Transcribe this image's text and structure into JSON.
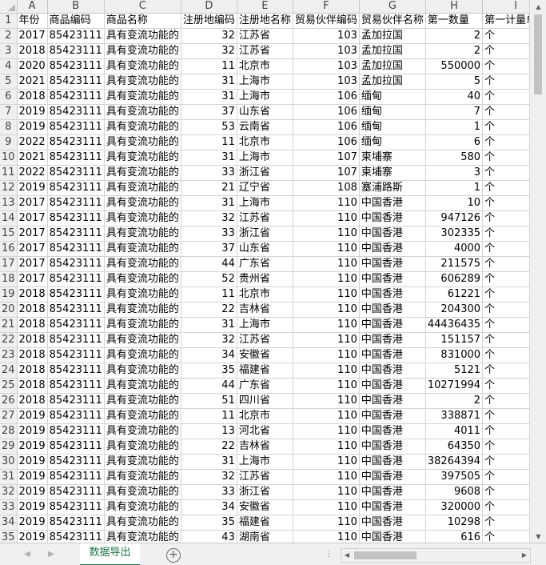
{
  "columns": [
    "A",
    "B",
    "C",
    "D",
    "E",
    "F",
    "G",
    "H",
    "I"
  ],
  "header_row": [
    "年份",
    "商品编码",
    "商品名称",
    "注册地编码",
    "注册地名称",
    "贸易伙伴编码",
    "贸易伙伴名称",
    "第一数量",
    "第一计量单位"
  ],
  "rows": [
    [
      "2017",
      "85423111",
      "具有变流功能的",
      "32",
      "江苏省",
      "103",
      "孟加拉国",
      "2",
      "个"
    ],
    [
      "2018",
      "85423111",
      "具有变流功能的",
      "32",
      "江苏省",
      "103",
      "孟加拉国",
      "2",
      "个"
    ],
    [
      "2020",
      "85423111",
      "具有变流功能的",
      "11",
      "北京市",
      "103",
      "孟加拉国",
      "550000",
      "个"
    ],
    [
      "2021",
      "85423111",
      "具有变流功能的",
      "31",
      "上海市",
      "103",
      "孟加拉国",
      "5",
      "个"
    ],
    [
      "2018",
      "85423111",
      "具有变流功能的",
      "31",
      "上海市",
      "106",
      "缅甸",
      "40",
      "个"
    ],
    [
      "2019",
      "85423111",
      "具有变流功能的",
      "37",
      "山东省",
      "106",
      "缅甸",
      "7",
      "个"
    ],
    [
      "2019",
      "85423111",
      "具有变流功能的",
      "53",
      "云南省",
      "106",
      "缅甸",
      "1",
      "个"
    ],
    [
      "2022",
      "85423111",
      "具有变流功能的",
      "11",
      "北京市",
      "106",
      "缅甸",
      "6",
      "个"
    ],
    [
      "2021",
      "85423111",
      "具有变流功能的",
      "31",
      "上海市",
      "107",
      "柬埔寨",
      "580",
      "个"
    ],
    [
      "2022",
      "85423111",
      "具有变流功能的",
      "33",
      "浙江省",
      "107",
      "柬埔寨",
      "3",
      "个"
    ],
    [
      "2019",
      "85423111",
      "具有变流功能的",
      "21",
      "辽宁省",
      "108",
      "塞浦路斯",
      "1",
      "个"
    ],
    [
      "2017",
      "85423111",
      "具有变流功能的",
      "31",
      "上海市",
      "110",
      "中国香港",
      "10",
      "个"
    ],
    [
      "2017",
      "85423111",
      "具有变流功能的",
      "32",
      "江苏省",
      "110",
      "中国香港",
      "947126",
      "个"
    ],
    [
      "2017",
      "85423111",
      "具有变流功能的",
      "33",
      "浙江省",
      "110",
      "中国香港",
      "302335",
      "个"
    ],
    [
      "2017",
      "85423111",
      "具有变流功能的",
      "37",
      "山东省",
      "110",
      "中国香港",
      "4000",
      "个"
    ],
    [
      "2017",
      "85423111",
      "具有变流功能的",
      "44",
      "广东省",
      "110",
      "中国香港",
      "211575",
      "个"
    ],
    [
      "2017",
      "85423111",
      "具有变流功能的",
      "52",
      "贵州省",
      "110",
      "中国香港",
      "606289",
      "个"
    ],
    [
      "2018",
      "85423111",
      "具有变流功能的",
      "11",
      "北京市",
      "110",
      "中国香港",
      "61221",
      "个"
    ],
    [
      "2018",
      "85423111",
      "具有变流功能的",
      "22",
      "吉林省",
      "110",
      "中国香港",
      "204300",
      "个"
    ],
    [
      "2018",
      "85423111",
      "具有变流功能的",
      "31",
      "上海市",
      "110",
      "中国香港",
      "44436435",
      "个"
    ],
    [
      "2018",
      "85423111",
      "具有变流功能的",
      "32",
      "江苏省",
      "110",
      "中国香港",
      "151157",
      "个"
    ],
    [
      "2018",
      "85423111",
      "具有变流功能的",
      "34",
      "安徽省",
      "110",
      "中国香港",
      "831000",
      "个"
    ],
    [
      "2018",
      "85423111",
      "具有变流功能的",
      "35",
      "福建省",
      "110",
      "中国香港",
      "5121",
      "个"
    ],
    [
      "2018",
      "85423111",
      "具有变流功能的",
      "44",
      "广东省",
      "110",
      "中国香港",
      "10271994",
      "个"
    ],
    [
      "2018",
      "85423111",
      "具有变流功能的",
      "51",
      "四川省",
      "110",
      "中国香港",
      "2",
      "个"
    ],
    [
      "2019",
      "85423111",
      "具有变流功能的",
      "11",
      "北京市",
      "110",
      "中国香港",
      "338871",
      "个"
    ],
    [
      "2019",
      "85423111",
      "具有变流功能的",
      "13",
      "河北省",
      "110",
      "中国香港",
      "4011",
      "个"
    ],
    [
      "2019",
      "85423111",
      "具有变流功能的",
      "22",
      "吉林省",
      "110",
      "中国香港",
      "64350",
      "个"
    ],
    [
      "2019",
      "85423111",
      "具有变流功能的",
      "31",
      "上海市",
      "110",
      "中国香港",
      "38264394",
      "个"
    ],
    [
      "2019",
      "85423111",
      "具有变流功能的",
      "32",
      "江苏省",
      "110",
      "中国香港",
      "397505",
      "个"
    ],
    [
      "2019",
      "85423111",
      "具有变流功能的",
      "33",
      "浙江省",
      "110",
      "中国香港",
      "9608",
      "个"
    ],
    [
      "2019",
      "85423111",
      "具有变流功能的",
      "34",
      "安徽省",
      "110",
      "中国香港",
      "320000",
      "个"
    ],
    [
      "2019",
      "85423111",
      "具有变流功能的",
      "35",
      "福建省",
      "110",
      "中国香港",
      "10298",
      "个"
    ],
    [
      "2019",
      "85423111",
      "具有变流功能的",
      "43",
      "湖南省",
      "110",
      "中国香港",
      "616",
      "个"
    ]
  ],
  "numeric_columns": [
    0,
    1,
    3,
    5,
    7
  ],
  "sheet_tab": "数据导出",
  "accent_color": "#1e7145",
  "icons": {
    "add_sheet": "plus-circle-icon",
    "prev_sheet": "triangle-left-icon",
    "next_sheet": "triangle-right-icon",
    "more": "vertical-dots-icon"
  }
}
